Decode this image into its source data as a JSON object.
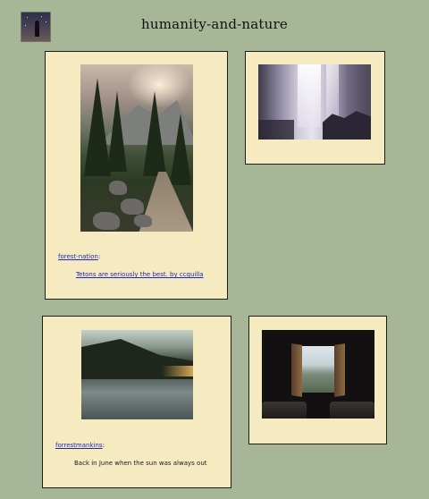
{
  "blog": {
    "title": "humanity-and-nature"
  },
  "posts": [
    {
      "source": "forest-nation",
      "separator": ":",
      "link_text": "Tetons are seriously the best. by ccquilla",
      "photo": "mountain forest trail"
    },
    {
      "photo": "waterfall"
    },
    {
      "source": "forrestmankins",
      "separator": ":",
      "caption": "Back in June when the sun was always out",
      "photo": "mountain lake"
    },
    {
      "photo": "open window view"
    }
  ],
  "colors": {
    "background": "#a7b696",
    "card": "#f5eac0",
    "link": "#1a29b8"
  }
}
